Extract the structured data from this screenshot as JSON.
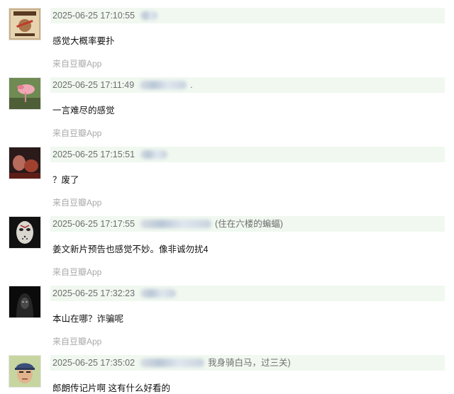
{
  "comments": [
    {
      "time": "2025-06-25 17:10:55",
      "name_tail": "",
      "content": "感觉大概率要扑",
      "source": "来自豆瓣App",
      "avatar_icon": "wanted-poster-avatar-icon"
    },
    {
      "time": "2025-06-25 17:11:49",
      "name_tail": ".",
      "content": "一言难尽的感觉",
      "source": "来自豆瓣App",
      "avatar_icon": "pink-bird-avatar-icon"
    },
    {
      "time": "2025-06-25 17:15:51",
      "name_tail": "",
      "content": "？废了",
      "source": "来自豆瓣App",
      "avatar_icon": "movie-still-avatar-icon"
    },
    {
      "time": "2025-06-25 17:17:55",
      "name_tail": "(住在六楼的蝙蝠)",
      "content": "姜文新片预告也感觉不妙。像非诚勿扰4",
      "source": "来自豆瓣App",
      "avatar_icon": "hockey-mask-avatar-icon"
    },
    {
      "time": "2025-06-25 17:32:23",
      "name_tail": "",
      "content": "本山在哪？诈骗呢",
      "source": "来自豆瓣App",
      "avatar_icon": "dark-hooded-figure-avatar-icon"
    },
    {
      "time": "2025-06-25 17:35:02",
      "name_tail": "我身骑白马，过三关)",
      "content": "郎朗传记片啊 这有什么好看的",
      "source": "",
      "avatar_icon": "cap-man-avatar-icon"
    }
  ]
}
